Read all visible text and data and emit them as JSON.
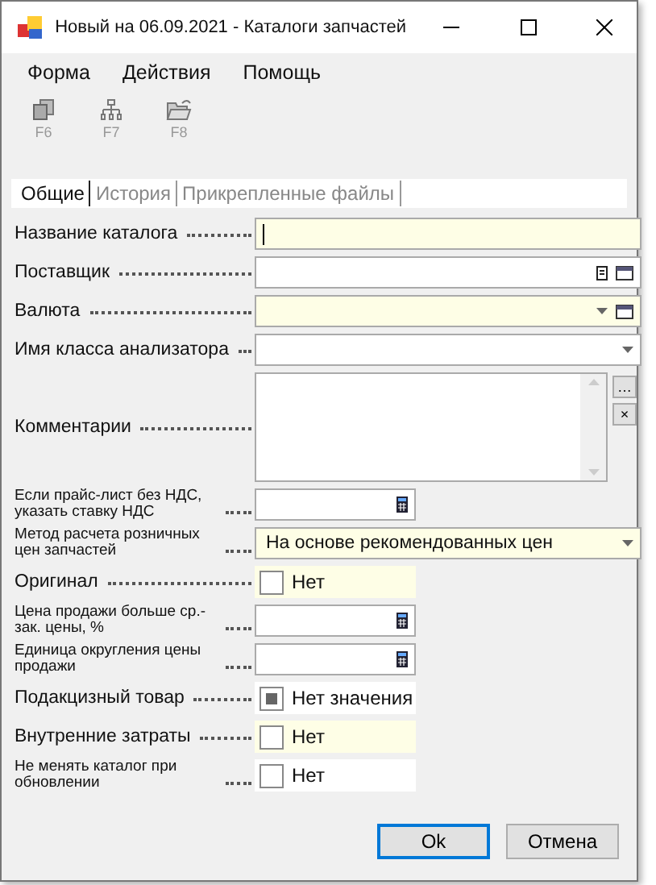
{
  "window": {
    "title": "Новый на 06.09.2021 - Каталоги запчастей"
  },
  "menu": [
    "Форма",
    "Действия",
    "Помощь"
  ],
  "toolbar": [
    {
      "label": "F6",
      "disabled": true
    },
    {
      "label": "F7",
      "disabled": true
    },
    {
      "label": "F8",
      "disabled": true
    }
  ],
  "tabs": [
    {
      "label": "Общие",
      "selected": true
    },
    {
      "label": "История",
      "selected": false
    },
    {
      "label": "Прикрепленные файлы",
      "selected": false
    }
  ],
  "fields": [
    {
      "label": "Название каталога",
      "kind": "text",
      "required": true,
      "focused": true
    },
    {
      "label": "Поставщик",
      "kind": "lookup",
      "required": false
    },
    {
      "label": "Валюта",
      "kind": "combo_button",
      "required": true
    },
    {
      "label": "Имя класса анализатора",
      "kind": "combo",
      "required": false
    },
    {
      "label": "Комментарии",
      "kind": "memo",
      "required": false,
      "buttons": [
        "…",
        "×"
      ]
    },
    {
      "label": "Если прайс-лист без НДС, указать ставку НДС",
      "kind": "number",
      "required": false
    },
    {
      "label": "Метод расчета розничных цен запчастей",
      "kind": "combo",
      "required": true,
      "value": "На основе рекомендованных цен"
    },
    {
      "label": "Оригинал",
      "kind": "check",
      "required": true,
      "checked": false,
      "indeterminate": false,
      "value": "Нет"
    },
    {
      "label": "Цена продажи больше ср.-зак. цены, %",
      "kind": "number",
      "required": false
    },
    {
      "label": "Единица округления цены продажи",
      "kind": "number",
      "required": false
    },
    {
      "label": "Подакцизный товар",
      "kind": "check",
      "required": false,
      "indeterminate": true,
      "value": "Нет значения"
    },
    {
      "label": "Внутренние затраты",
      "kind": "check",
      "required": true,
      "checked": false,
      "indeterminate": false,
      "value": "Нет"
    },
    {
      "label": "Не менять каталог при обновлении",
      "kind": "check",
      "required": false,
      "checked": false,
      "indeterminate": false,
      "value": "Нет"
    }
  ],
  "buttons": [
    {
      "label": "Ok",
      "default": true
    },
    {
      "label": "Отмена",
      "default": false
    }
  ]
}
